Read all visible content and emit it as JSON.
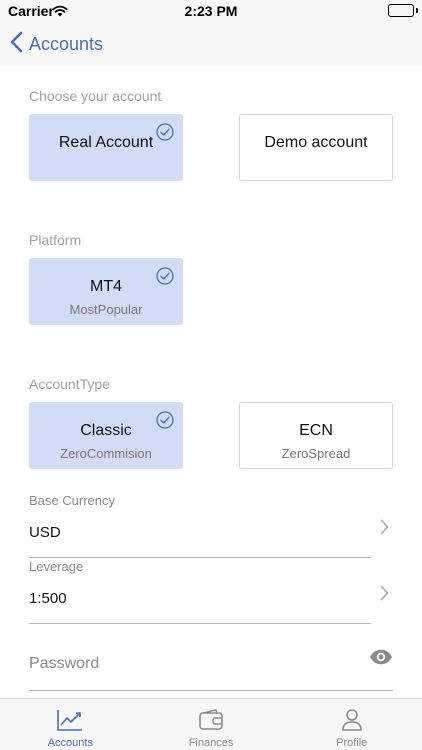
{
  "status_bar": {
    "carrier": "Carrier",
    "time": "2:23 PM",
    "battery_level": 1.0
  },
  "nav": {
    "back_label": "Accounts"
  },
  "account_section": {
    "label": "Choose your account",
    "options": [
      {
        "title": "Real Account",
        "selected": true
      },
      {
        "title": "Demo account",
        "selected": false
      }
    ]
  },
  "platform_section": {
    "label": "Platform",
    "options": [
      {
        "title": "MT4",
        "subtitle": "MostPopular",
        "selected": true
      }
    ]
  },
  "account_type_section": {
    "label": "AccountType",
    "options": [
      {
        "title": "Classic",
        "subtitle": "ZeroCommision",
        "selected": true
      },
      {
        "title": "ECN",
        "subtitle": "ZeroSpread",
        "selected": false
      }
    ]
  },
  "base_currency": {
    "label": "Base Currency",
    "value": "USD"
  },
  "leverage": {
    "label": "Leverage",
    "value": "1:500"
  },
  "password": {
    "placeholder": "Password",
    "value": ""
  },
  "tabs": [
    {
      "label": "Accounts",
      "icon": "chart-icon",
      "active": true
    },
    {
      "label": "Finances",
      "icon": "wallet-icon",
      "active": false
    },
    {
      "label": "Profile",
      "icon": "person-icon",
      "active": false
    }
  ],
  "colors": {
    "accent": "#4a6fb5",
    "selected_card": "#d3dcf6",
    "muted_text": "#a3a3a3"
  }
}
